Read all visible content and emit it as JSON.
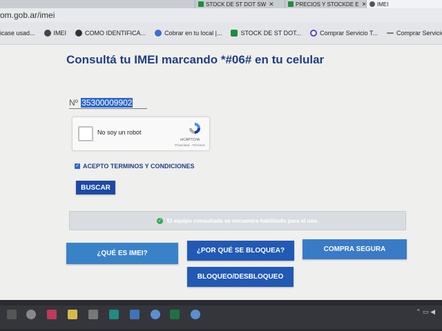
{
  "browser": {
    "tabs": [
      {
        "label": "STOCK DE ST DOT SW"
      },
      {
        "label": "PRECIOS Y STOCKDE E"
      },
      {
        "label": "IMEI"
      }
    ],
    "url": "om.gob.ar/imei",
    "bookmarks": [
      {
        "label": "icase usad..."
      },
      {
        "label": "IMEI"
      },
      {
        "label": "COMO IDENTIFICA..."
      },
      {
        "label": "Cobrar en tu local |..."
      },
      {
        "label": "STOCK DE ST DOT..."
      },
      {
        "label": "Comprar Servicio T..."
      },
      {
        "label": "Comprar Servicio T..."
      }
    ]
  },
  "page": {
    "title": "Consultá tu IMEI marcando *#06# en tu celular",
    "imei_prefix": "Nº",
    "imei_value": "35300009902",
    "recaptcha": {
      "label": "No soy un robot",
      "brand": "reCAPTCHA",
      "links": "Privacidad - Términos"
    },
    "terms_label": "ACEPTO TERMINOS Y CONDICIONES",
    "search_button": "BUSCAR",
    "status_message": "El equipo consultado se encuentra habilitado para el uso.",
    "buttons": {
      "que_es": "¿QUÉ ES IMEI?",
      "por_que": "¿POR QUÉ SE BLOQUEA?",
      "compra": "COMPRA SEGURA",
      "bloqueo": "BLOQUEO/DESBLOQUEO"
    }
  },
  "colors": {
    "title": "#1f3f86",
    "primary_button": "#2159b4",
    "light_button": "#3a82c8",
    "status_ok": "#35a853"
  }
}
